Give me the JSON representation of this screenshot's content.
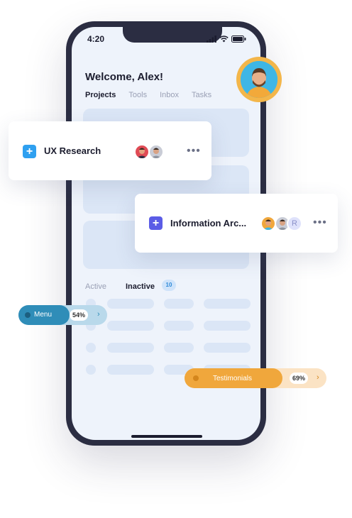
{
  "status_bar": {
    "time": "4:20"
  },
  "header": {
    "welcome": "Welcome, Alex!"
  },
  "tabs": [
    {
      "label": "Projects"
    },
    {
      "label": "Tools"
    },
    {
      "label": "Inbox"
    },
    {
      "label": "Tasks"
    }
  ],
  "segments": {
    "active_label": "Active",
    "inactive_label": "Inactive",
    "inactive_count": "10"
  },
  "cards": [
    {
      "title": "UX Research",
      "more": "•••",
      "plus": "+"
    },
    {
      "title": "Information Arc...",
      "more": "•••",
      "plus": "+",
      "extra_avatar_letter": "R"
    }
  ],
  "pills": {
    "menu": {
      "label": "Menu",
      "percent": "54%",
      "progress": 0.54
    },
    "testimonials": {
      "label": "Testimonials",
      "percent": "69%",
      "progress": 0.69
    }
  },
  "colors": {
    "phone_frame": "#2b2d42",
    "screen_bg": "#eef3fb",
    "placeholder": "#dbe6f6",
    "card_plus_blue": "#2fa0f0",
    "card_plus_indigo": "#5b5ce6",
    "menu_pill": "#2f8db8",
    "menu_pill_track": "#b9d9eb",
    "testimonials_pill": "#f0a73c",
    "testimonials_pill_track": "#fbe3c4",
    "avatar_ring": "#f3b64a"
  },
  "icons": [
    "signal-icon",
    "wifi-icon",
    "battery-icon",
    "plus-icon",
    "more-icon",
    "chevron-right-icon",
    "user-avatar-icon"
  ]
}
